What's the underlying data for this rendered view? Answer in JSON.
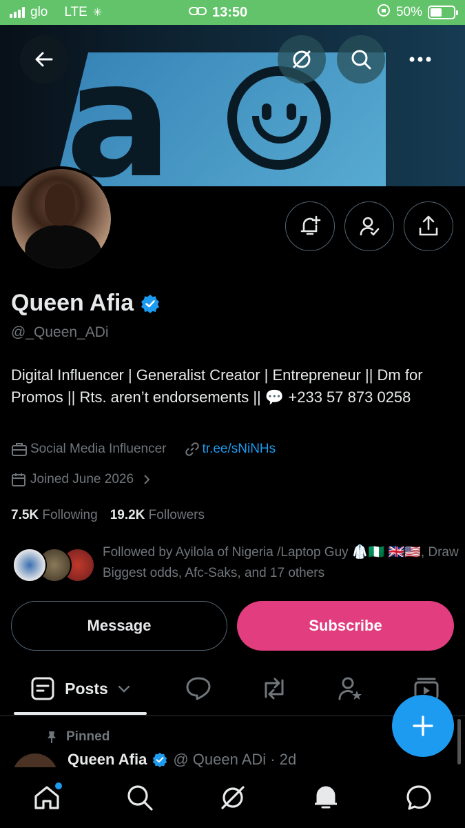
{
  "status_bar": {
    "carrier": "glo",
    "network": "LTE",
    "time": "13:50",
    "battery": "50%",
    "battery_level": 0.5
  },
  "header": {
    "back_icon": "arrow-left-icon",
    "grok_icon": "grok-icon",
    "search_icon": "search-icon",
    "more_icon": "more-horizontal-icon"
  },
  "profile": {
    "name": "Queen Afia",
    "handle": "@_Queen_ADi",
    "bio": "Digital Influencer | Generalist Creator | Entrepreneur || Dm for Promos || Rts. aren’t endorsements || 💬 +233 57 873 0258",
    "category": "Social Media Influencer",
    "link": "tr.ee/sNiNHs",
    "joined": "Joined June 2026",
    "following_count": "7.5K",
    "following_label": "Following",
    "followers_count": "19.2K",
    "followers_label": "Followers",
    "followed_by": "Followed by Ayilola of Nigeria /Laptop Guy 🥼🇳🇬 🇬🇧🇺🇸, Draw Biggest odds, Afc-Saks, and 17 others"
  },
  "actions": {
    "message_label": "Message",
    "subscribe_label": "Subscribe"
  },
  "tabs": {
    "posts_label": "Posts"
  },
  "pinned_post": {
    "pinned_label": "Pinned",
    "author_name": "Queen Afia",
    "author_handle_time": "@ Queen ADi · 2d"
  },
  "colors": {
    "accent": "#1d9bf0",
    "subscribe": "#e23d7f",
    "status_bar": "#62c36a",
    "muted": "#71767b"
  }
}
